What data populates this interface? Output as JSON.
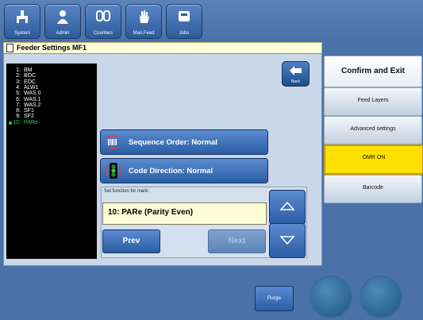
{
  "toolbar": {
    "buttons": [
      {
        "label": "System",
        "icon": "system-icon"
      },
      {
        "label": "Admin",
        "icon": "admin-person-icon"
      },
      {
        "label": "Counters",
        "icon": "counters-icon"
      },
      {
        "label": "Man.Feed",
        "icon": "hand-icon"
      },
      {
        "label": "Jobs",
        "icon": "jobs-icon"
      }
    ]
  },
  "header": {
    "title": "Feeder Settings MF1"
  },
  "mark_list": {
    "items": [
      {
        "num": "1:",
        "label": "BM"
      },
      {
        "num": "2:",
        "label": "BOC"
      },
      {
        "num": "3:",
        "label": "EOC"
      },
      {
        "num": "4:",
        "label": "ALW1"
      },
      {
        "num": "5:",
        "label": "WAS.0"
      },
      {
        "num": "6:",
        "label": "WAS.1"
      },
      {
        "num": "7:",
        "label": "WAS.2"
      },
      {
        "num": "8:",
        "label": "SF1"
      },
      {
        "num": "9:",
        "label": "SF2"
      },
      {
        "num": "10:",
        "label": "PARe"
      }
    ],
    "selected_index": 9
  },
  "back": {
    "label": "Back"
  },
  "sequence_button": {
    "label": "Sequence Order: Normal"
  },
  "code_direction_button": {
    "label": "Code Direction: Normal"
  },
  "set_function": {
    "label": "Set function for mark:",
    "value": "10: PARe (Parity Even)"
  },
  "nav": {
    "prev_label": "Prev",
    "next_label": "Next"
  },
  "side_menu": {
    "confirm_label": "Confirm and Exit",
    "feed_layers_label": "Feed Layers",
    "advanced_label": "Advanced settings",
    "omr_label": "OMR ON",
    "barcode_label": "Barcode"
  },
  "footer": {
    "purge_label": "Purge"
  },
  "colors": {
    "background": "#4a72a8",
    "button_blue": "#2b5ea6",
    "panel": "#c9d7e8",
    "omr_active": "#ffe000",
    "field_bg": "#fffdd8",
    "list_selected_dot": "#3ccb3c"
  }
}
